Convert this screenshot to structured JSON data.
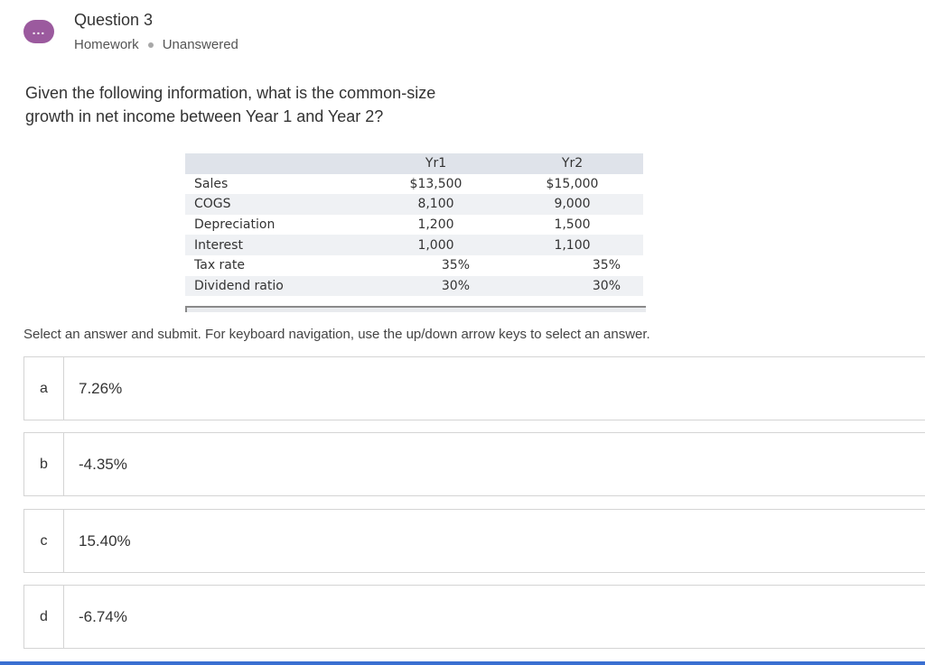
{
  "header": {
    "icon": "ellipsis-icon",
    "icon_glyph": "...",
    "title": "Question 3",
    "type": "Homework",
    "status": "Unanswered"
  },
  "prompt": {
    "line1": "Given the following information, what is the common-size",
    "line2": "growth in net income between Year 1 and Year 2?"
  },
  "table": {
    "headers": {
      "label": "",
      "yr1": "Yr1",
      "yr2": "Yr2"
    },
    "rows": [
      {
        "label": "Sales",
        "yr1": "$13,500",
        "yr2": "$15,000"
      },
      {
        "label": "COGS",
        "yr1": "8,100",
        "yr2": "9,000"
      },
      {
        "label": "Depreciation",
        "yr1": "1,200",
        "yr2": "1,500"
      },
      {
        "label": "Interest",
        "yr1": "1,000",
        "yr2": "1,100"
      },
      {
        "label": "Tax rate",
        "yr1": "35%",
        "yr2": "35%"
      },
      {
        "label": "Dividend ratio",
        "yr1": "30%",
        "yr2": "30%"
      }
    ]
  },
  "instruction": "Select an answer and submit. For keyboard navigation, use the up/down arrow keys to select an answer.",
  "options": [
    {
      "letter": "a",
      "value": "7.26%"
    },
    {
      "letter": "b",
      "value": "-4.35%"
    },
    {
      "letter": "c",
      "value": "15.40%"
    },
    {
      "letter": "d",
      "value": "-6.74%"
    }
  ],
  "colors": {
    "icon_bg": "#9b5a9e",
    "accent_bar": "#3a6fd1",
    "table_header": "#dfe3ea",
    "table_shade": "#eff1f4"
  }
}
